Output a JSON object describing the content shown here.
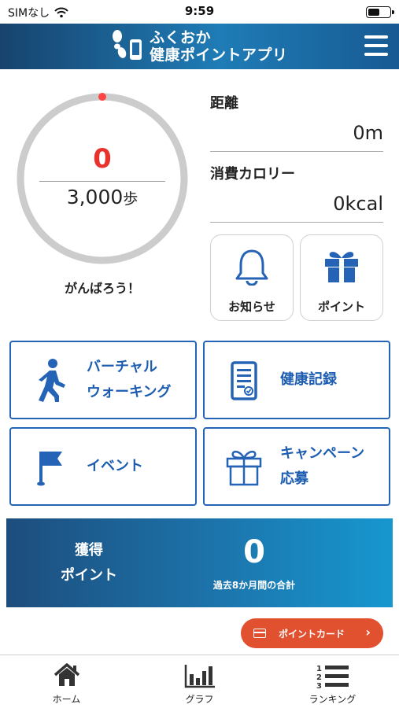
{
  "status_bar": {
    "carrier": "SIMなし",
    "time": "9:59"
  },
  "header": {
    "title_line1": "ふくおか",
    "title_line2": "健康ポイントアプリ",
    "menu_icon": "hamburger-icon"
  },
  "progress": {
    "steps": "0",
    "goal": "3,000",
    "goal_unit": "歩",
    "percent": 0,
    "message": "がんばろう！"
  },
  "stats": {
    "distance_label": "距離",
    "distance_value": "0m",
    "calorie_label": "消費カロリー",
    "calorie_value": "0kcal"
  },
  "quick_tiles": [
    {
      "label": "お知らせ",
      "icon": "bell-icon"
    },
    {
      "label": "ポイント",
      "icon": "gift-icon"
    }
  ],
  "menu_tiles": [
    {
      "label": "バーチャル\nウォーキング",
      "icon": "walking-person-icon"
    },
    {
      "label": "健康記録",
      "icon": "health-record-icon"
    },
    {
      "label": "イベント",
      "icon": "flag-icon"
    },
    {
      "label": "キャンペーン\n応募",
      "icon": "gift-box-icon"
    }
  ],
  "points": {
    "label": "獲得\nポイント",
    "value": "0",
    "note": "過去8か月間の合計"
  },
  "point_card_button": {
    "label": "ポイントカード",
    "icon": "card-icon"
  },
  "tabs": [
    {
      "label": "ホーム",
      "icon": "home-icon"
    },
    {
      "label": "グラフ",
      "icon": "bar-chart-icon"
    },
    {
      "label": "ランキング",
      "icon": "ranking-list-icon"
    }
  ],
  "colors": {
    "primary": "#2563b6",
    "accent_red": "#e8322e",
    "button_orange": "#e1502f",
    "header_dark": "#17436e"
  }
}
